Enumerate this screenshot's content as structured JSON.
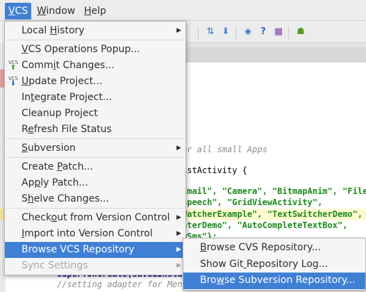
{
  "menubar": {
    "items": [
      {
        "label": "VCS",
        "u": "V"
      },
      {
        "label": "Window",
        "u": "W"
      },
      {
        "label": "Help",
        "u": "H"
      }
    ]
  },
  "vcs_menu": {
    "items": [
      {
        "label": "Local History",
        "u": 6,
        "submenu": true
      },
      {
        "label": "VCS Operations Popup...",
        "u": 0
      },
      {
        "label": "Commit Changes...",
        "u": 4,
        "icon": "vcs-commit-icon"
      },
      {
        "label": "Update Project...",
        "u": 0,
        "icon": "vcs-update-icon"
      },
      {
        "label": "Integrate Project...",
        "u": 2
      },
      {
        "label": "Cleanup Project",
        "u": -1
      },
      {
        "label": "Refresh File Status",
        "u": 1
      },
      {
        "label": "Subversion",
        "u": 0,
        "submenu": true
      },
      {
        "label": "Create Patch...",
        "u": 7
      },
      {
        "label": "Apply Patch...",
        "u": 2
      },
      {
        "label": "Shelve Changes...",
        "u": 1
      },
      {
        "label": "Checkout from Version Control",
        "u": 5,
        "submenu": true
      },
      {
        "label": "Import into Version Control",
        "u": 0,
        "submenu": true
      },
      {
        "label": "Browse VCS Repository",
        "u": -1,
        "submenu": true,
        "hover": true
      },
      {
        "label": "Sync Settings",
        "u": -1,
        "submenu": true,
        "disabled": true
      }
    ]
  },
  "browse_submenu": {
    "items": [
      {
        "label": "Browse CVS Repository...",
        "u": 0
      },
      {
        "label": "Show Git Repository Log...",
        "u": 8
      },
      {
        "label": "Browse Subversion Repository...",
        "u": 3,
        "hover": true
      }
    ]
  },
  "editor": {
    "comment_top": "or all small Apps",
    "class_decl": "istActivity {",
    "str_line1": "Email\", \"Camera\", \"BitmapAnim\", \"File",
    "str_line2": "Speech\", \"GridViewActivity\",",
    "str_line3": "WatcherExample\", \"TextSwitcherDemo\",",
    "str_line4": "aterDemo\", \"AutoCompleteTextBox\",",
    "str_line5": "wSms\"};",
    "super_line": "super.onCreate(savedInstan",
    "comment_bottom": "//setting adapter for Menu"
  },
  "colors": {
    "accent": "#3f80d5",
    "string": "#1a8a1a",
    "comment": "#8c8c8c"
  }
}
